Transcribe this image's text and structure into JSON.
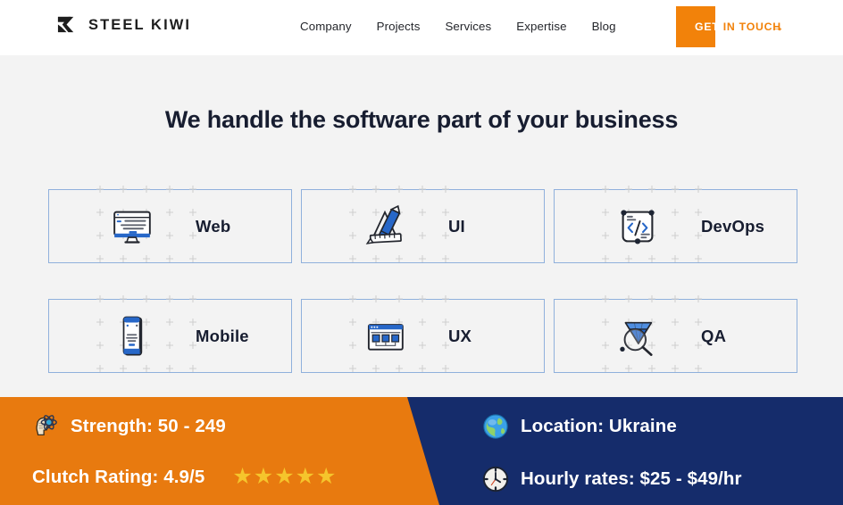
{
  "header": {
    "logo": {
      "icon": "sk-monogram-icon",
      "text": "STEEL KIWI"
    },
    "nav": [
      {
        "label": "Company"
      },
      {
        "label": "Projects"
      },
      {
        "label": "Services"
      },
      {
        "label": "Expertise"
      },
      {
        "label": "Blog"
      }
    ],
    "cta": {
      "highlight": "GET",
      "rest": " IN TOUCH",
      "full_label": "GET IN TOUCH",
      "arrow": "→",
      "bg_color": "#f2820a"
    }
  },
  "main": {
    "headline": "We handle the software part of your business",
    "cards": [
      {
        "label": "Web",
        "icon": "desktop-monitor-icon"
      },
      {
        "label": "UI",
        "icon": "pencil-ruler-icon"
      },
      {
        "label": "DevOps",
        "icon": "code-brackets-icon"
      },
      {
        "label": "Mobile",
        "icon": "smartphone-icon"
      },
      {
        "label": "UX",
        "icon": "wireframe-window-icon"
      },
      {
        "label": "QA",
        "icon": "magnifier-gem-icon"
      }
    ]
  },
  "footer": {
    "orange_color": "#e87a0f",
    "navy_color": "#152c6b",
    "stats": [
      {
        "icon": "brain-atom-icon",
        "text": "Strength: 50 - 249"
      },
      {
        "icon": "clutch-stars-icon",
        "text": "Clutch Rating: 4.9/5",
        "stars": 5,
        "star_glyph": "★",
        "star_color": "#f5c52c"
      },
      {
        "icon": "globe-icon",
        "text": "Location: Ukraine"
      },
      {
        "icon": "clock-icon",
        "text": "Hourly rates: $25 - $49/hr"
      }
    ]
  }
}
